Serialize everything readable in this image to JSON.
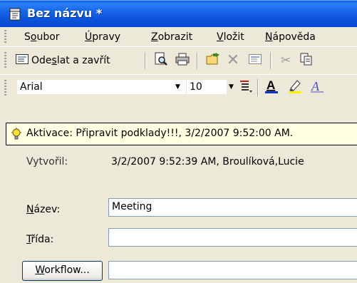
{
  "window": {
    "title": "Bez názvu *"
  },
  "menu": [
    {
      "pre": "S",
      "ul": "o",
      "post": "ubor"
    },
    {
      "pre": "",
      "ul": "Ú",
      "post": "pravy"
    },
    {
      "pre": "",
      "ul": "Z",
      "post": "obrazit"
    },
    {
      "pre": "",
      "ul": "V",
      "post": "ložit"
    },
    {
      "pre": "",
      "ul": "N",
      "post": "ápověda"
    }
  ],
  "toolbar": {
    "send_pre": "Ode",
    "send_ul": "s",
    "send_post": "lat a zavřít"
  },
  "format": {
    "font": "Arial",
    "size": "10"
  },
  "infobar": {
    "text": "Aktivace: Připravit podklady!!!, 3/2/2007 9:52:00 AM."
  },
  "form": {
    "created_label": "Vytvořil:",
    "created_value": "3/2/2007 9:52:39 AM, Broulíková,Lucie",
    "name_label_ul": "N",
    "name_label_post": "ázev:",
    "name_value": "Meeting",
    "class_label_ul": "T",
    "class_label_post": "řída:",
    "class_value": "",
    "workflow_ul": "W",
    "workflow_post": "orkflow...",
    "workflow_value": ""
  },
  "colors": {
    "title_bar": "#0B4FD8",
    "infobar_bg": "#FFFFE1",
    "face": "#ECE9D8"
  }
}
